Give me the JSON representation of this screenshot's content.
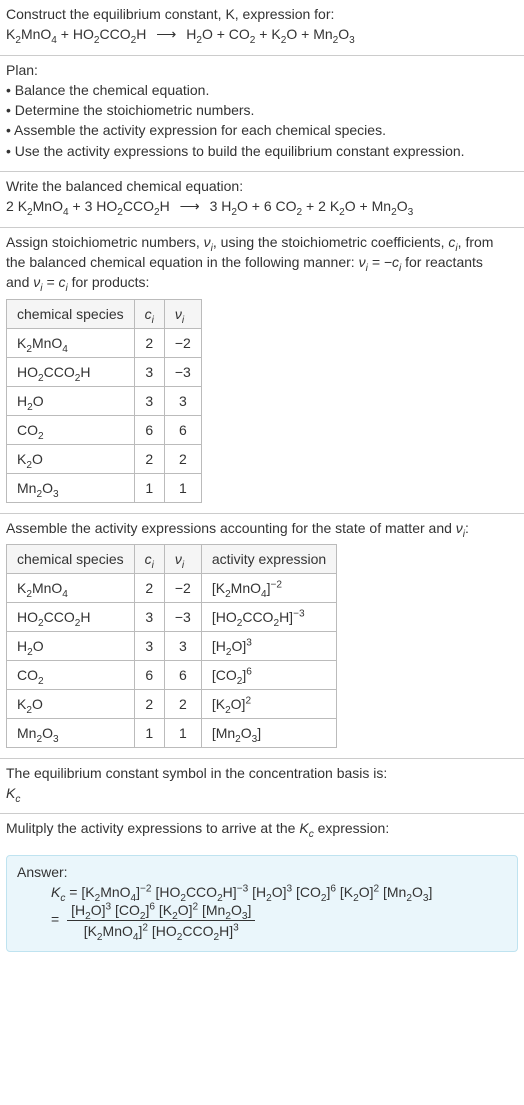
{
  "header": {
    "line1": "Construct the equilibrium constant, K, expression for:",
    "equation_parts": {
      "r1": "K",
      "r1s": "2",
      "r1b": "MnO",
      "r1bs": "4",
      "plus1": " + ",
      "r2a": "HO",
      "r2as": "2",
      "r2b": "CCO",
      "r2bs": "2",
      "r2c": "H",
      "arrow": "⟶",
      "p1": "H",
      "p1s": "2",
      "p1b": "O",
      "plus2": " + ",
      "p2": "CO",
      "p2s": "2",
      "plus3": " + ",
      "p3": "K",
      "p3s": "2",
      "p3b": "O",
      "plus4": " + ",
      "p4": "Mn",
      "p4s": "2",
      "p4b": "O",
      "p4bs": "3"
    }
  },
  "plan": {
    "title": "Plan:",
    "b1": "• Balance the chemical equation.",
    "b2": "• Determine the stoichiometric numbers.",
    "b3": "• Assemble the activity expression for each chemical species.",
    "b4": "• Use the activity expressions to build the equilibrium constant expression."
  },
  "balanced": {
    "title": "Write the balanced chemical equation:",
    "c1": "2 ",
    "r1": "K",
    "r1s": "2",
    "r1b": "MnO",
    "r1bs": "4",
    "plus1": " + ",
    "c2": "3 ",
    "r2a": "HO",
    "r2as": "2",
    "r2b": "CCO",
    "r2bs": "2",
    "r2c": "H",
    "arrow": "⟶",
    "c3": "3 ",
    "p1": "H",
    "p1s": "2",
    "p1b": "O",
    "plus2": " + ",
    "c4": "6 ",
    "p2": "CO",
    "p2s": "2",
    "plus3": " + ",
    "c5": "2 ",
    "p3": "K",
    "p3s": "2",
    "p3b": "O",
    "plus4": " + ",
    "p4": "Mn",
    "p4s": "2",
    "p4b": "O",
    "p4bs": "3"
  },
  "assign": {
    "l1a": "Assign stoichiometric numbers, ",
    "l1b": ", using the stoichiometric coefficients, ",
    "l1c": ", from",
    "l2a": "the balanced chemical equation in the following manner: ",
    "l2b": " for reactants",
    "l3a": "and ",
    "l3b": " for products:",
    "nu": "ν",
    "nui": "i",
    "ci": "c",
    "cii": "i",
    "eq1a": "ν",
    "eq1b": " = −c",
    "eq2a": "ν",
    "eq2b": " = c"
  },
  "table1": {
    "h1": "chemical species",
    "h2": "c",
    "h2s": "i",
    "h3": "ν",
    "h3s": "i",
    "rows": [
      {
        "sp": {
          "a": "K",
          "as": "2",
          "b": "MnO",
          "bs": "4"
        },
        "c": "2",
        "n": "−2"
      },
      {
        "sp": {
          "a": "HO",
          "as": "2",
          "b": "CCO",
          "bs": "2",
          "c": "H"
        },
        "c": "3",
        "n": "−3"
      },
      {
        "sp": {
          "a": "H",
          "as": "2",
          "b": "O"
        },
        "c": "3",
        "n": "3"
      },
      {
        "sp": {
          "a": "CO",
          "as": "2"
        },
        "c": "6",
        "n": "6"
      },
      {
        "sp": {
          "a": "K",
          "as": "2",
          "b": "O"
        },
        "c": "2",
        "n": "2"
      },
      {
        "sp": {
          "a": "Mn",
          "as": "2",
          "b": "O",
          "bs": "3"
        },
        "c": "1",
        "n": "1"
      }
    ]
  },
  "assemble": {
    "l1a": "Assemble the activity expressions accounting for the state of matter and ",
    "l1b": ":",
    "nu": "ν",
    "nui": "i"
  },
  "table2": {
    "h1": "chemical species",
    "h2": "c",
    "h2s": "i",
    "h3": "ν",
    "h3s": "i",
    "h4": "activity expression",
    "rows": [
      {
        "sp": {
          "a": "K",
          "as": "2",
          "b": "MnO",
          "bs": "4"
        },
        "c": "2",
        "n": "−2",
        "exp": "−2"
      },
      {
        "sp": {
          "a": "HO",
          "as": "2",
          "b": "CCO",
          "bs": "2",
          "c": "H"
        },
        "c": "3",
        "n": "−3",
        "exp": "−3"
      },
      {
        "sp": {
          "a": "H",
          "as": "2",
          "b": "O"
        },
        "c": "3",
        "n": "3",
        "exp": "3"
      },
      {
        "sp": {
          "a": "CO",
          "as": "2"
        },
        "c": "6",
        "n": "6",
        "exp": "6"
      },
      {
        "sp": {
          "a": "K",
          "as": "2",
          "b": "O"
        },
        "c": "2",
        "n": "2",
        "exp": "2"
      },
      {
        "sp": {
          "a": "Mn",
          "as": "2",
          "b": "O",
          "bs": "3"
        },
        "c": "1",
        "n": "1",
        "exp": ""
      }
    ]
  },
  "symbol": {
    "l1": "The equilibrium constant symbol in the concentration basis is:",
    "K": "K",
    "Kc": "c"
  },
  "multiply": {
    "l1a": "Mulitply the activity expressions to arrive at the ",
    "l1b": " expression:",
    "K": "K",
    "Kc": "c"
  },
  "answer": {
    "label": "Answer:",
    "Kc_K": "K",
    "Kc_c": "c",
    "eq": " = ",
    "p_eq": "= ",
    "e_m2": "−2",
    "e_m3": "−3",
    "e3": "3",
    "e6": "6",
    "e2": "2"
  },
  "species": {
    "k2mno4": {
      "a": "K",
      "as": "2",
      "b": "MnO",
      "bs": "4"
    },
    "ox": {
      "a": "HO",
      "as": "2",
      "b": "CCO",
      "bs": "2",
      "c": "H"
    },
    "h2o": {
      "a": "H",
      "as": "2",
      "b": "O"
    },
    "co2": {
      "a": "CO",
      "as": "2"
    },
    "k2o": {
      "a": "K",
      "as": "2",
      "b": "O"
    },
    "mn2o3": {
      "a": "Mn",
      "as": "2",
      "b": "O",
      "bs": "3"
    }
  }
}
